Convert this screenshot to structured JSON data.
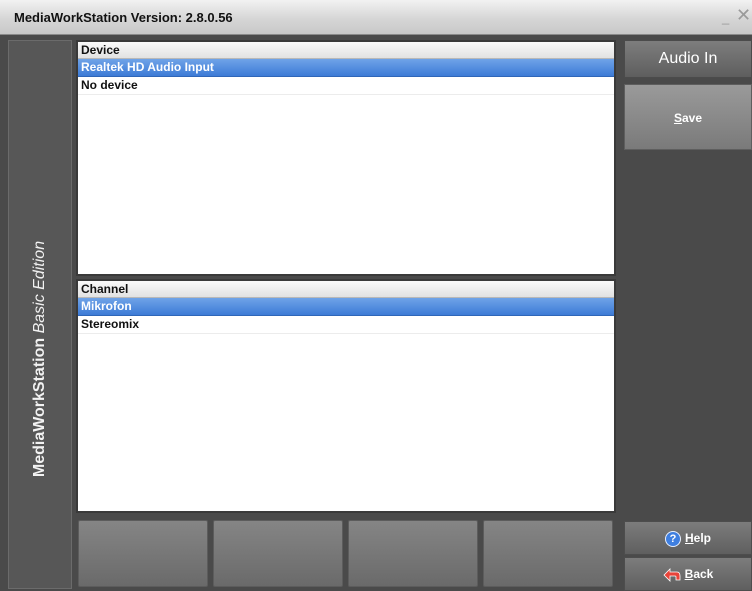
{
  "window": {
    "title": "MediaWorkStation Version: 2.8.0.56",
    "minimize_glyph": "_",
    "close_glyph": "✕"
  },
  "sidebar": {
    "brand": "MediaWorkStation",
    "edition": "Basic Edition"
  },
  "device_panel": {
    "header": "Device",
    "items": [
      {
        "label": "Realtek HD Audio Input",
        "selected": true
      },
      {
        "label": "No device",
        "selected": false
      }
    ]
  },
  "channel_panel": {
    "header": "Channel",
    "items": [
      {
        "label": "Mikrofon",
        "selected": true
      },
      {
        "label": "Stereomix",
        "selected": false
      }
    ]
  },
  "right_panel": {
    "header": "Audio In",
    "save": {
      "first": "S",
      "rest": "ave"
    },
    "help": {
      "first": "H",
      "rest": "elp",
      "icon": "help-icon"
    },
    "back": {
      "first": "B",
      "rest": "ack",
      "icon": "back-arrow-icon"
    }
  },
  "colors": {
    "selection": "#3d7bd6",
    "background": "#4a4a4a"
  }
}
